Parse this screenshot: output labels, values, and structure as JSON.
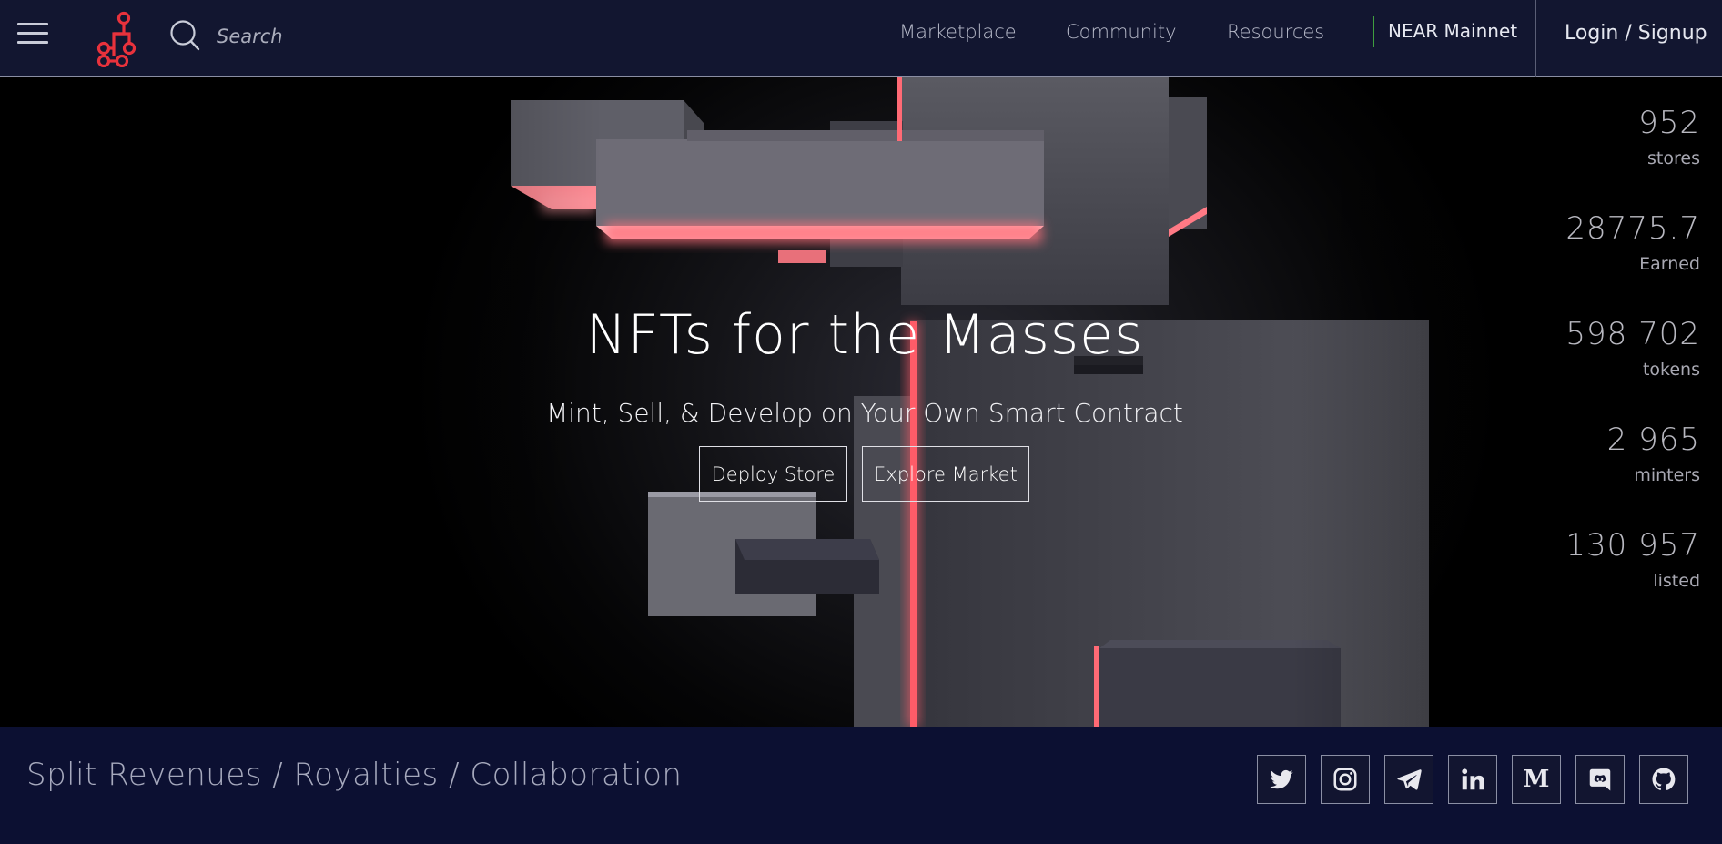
{
  "nav": {
    "search_placeholder": "Search",
    "links": [
      "Marketplace",
      "Community",
      "Resources"
    ],
    "network": "NEAR Mainnet",
    "login": "Login / Signup"
  },
  "hero": {
    "title": "NFTs for the Masses",
    "subtitle": "Mint, Sell, & Develop on Your Own Smart Contract",
    "buttons": {
      "deploy": "Deploy Store",
      "explore": "Explore Market"
    },
    "stats": [
      {
        "value": "952",
        "label": "stores"
      },
      {
        "value": "28775.7",
        "label": "Earned"
      },
      {
        "value": "598 702",
        "label": "tokens"
      },
      {
        "value": "2 965",
        "label": "minters"
      },
      {
        "value": "130 957",
        "label": "listed"
      }
    ]
  },
  "footer": {
    "tagline": "Split Revenues / Royalties / Collaboration",
    "social_icons": [
      "twitter-icon",
      "instagram-icon",
      "telegram-icon",
      "linkedin-icon",
      "medium-icon",
      "discord-icon",
      "github-icon"
    ],
    "medium_glyph": "M"
  },
  "colors": {
    "nav_bg": "#121630",
    "footer_bg": "#0c1032",
    "logo_red": "#e8323c",
    "glow_pink": "#ff6f7a",
    "network_divider": "#3f9f3f"
  }
}
